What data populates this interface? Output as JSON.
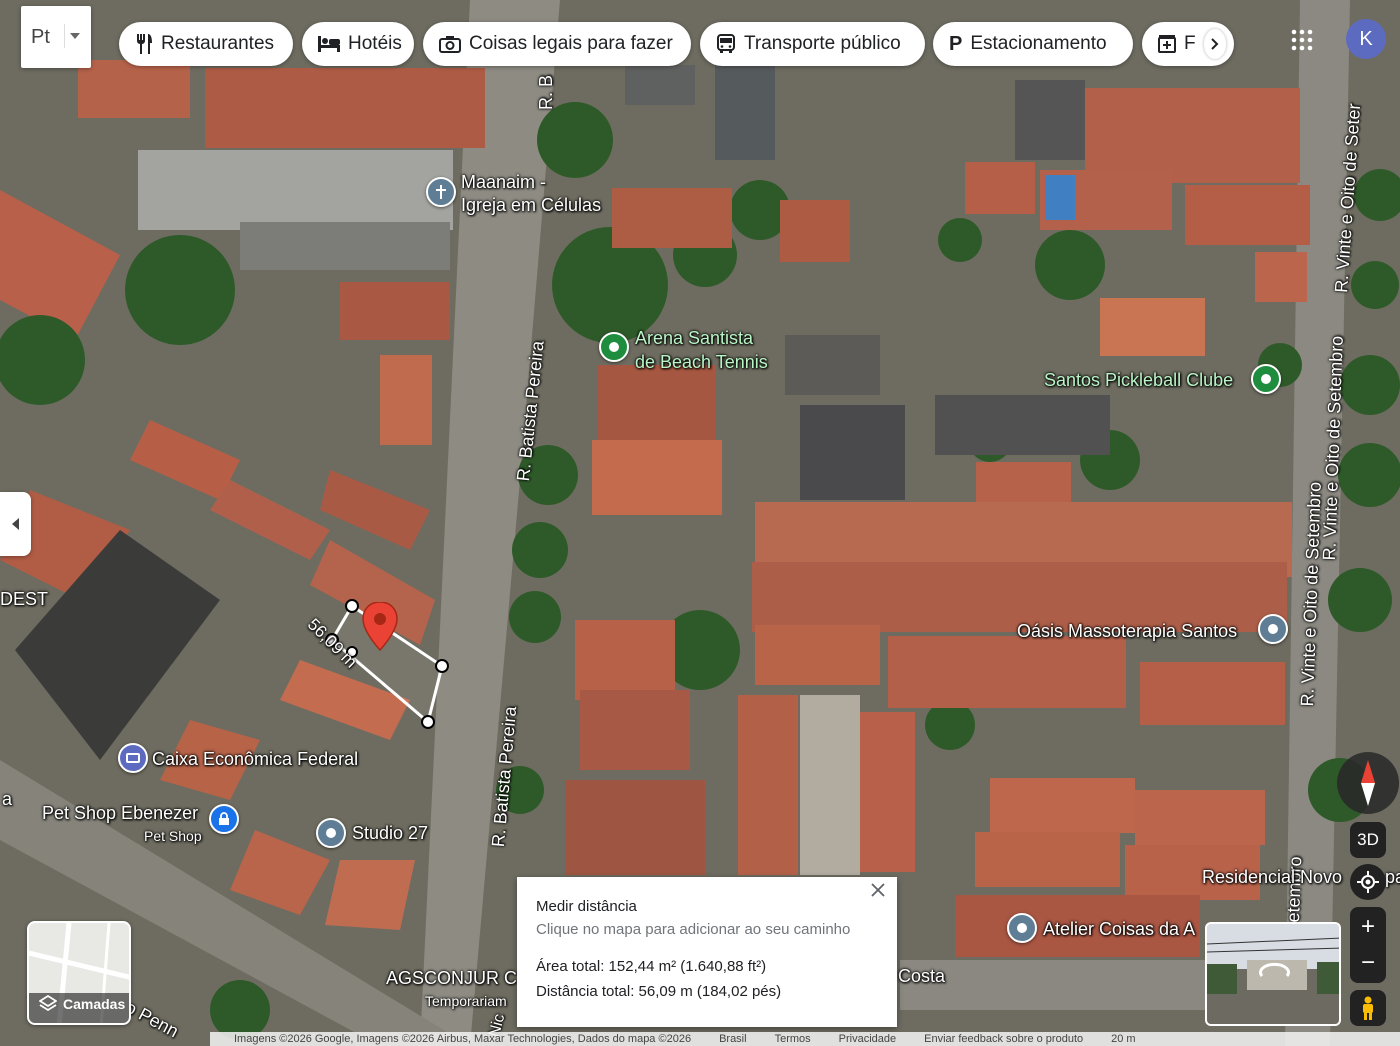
{
  "search_box": {
    "value": "Pt"
  },
  "categories": [
    {
      "label": "Restaurantes",
      "icon": "fork-knife-icon"
    },
    {
      "label": "Hotéis",
      "icon": "bed-icon"
    },
    {
      "label": "Coisas legais para fazer",
      "icon": "camera-icon"
    },
    {
      "label": "Transporte público",
      "icon": "bus-icon"
    },
    {
      "label": "Estacionamento",
      "icon": "parking-icon"
    },
    {
      "label": "F",
      "icon": "pharmacy-icon"
    }
  ],
  "account": {
    "initial": "K",
    "color": "#5c6bc0"
  },
  "streets": {
    "batista_1": "R. Batista Pereira",
    "batista_2": "R. Batista Pereira",
    "batista_top": "R. B",
    "vinte_1": "R. Vinte e Oito de Seter",
    "vinte_2": "R. Vinte e Oito de Setembro",
    "vinte_3": "R. Vinte e Oito de Setembro",
    "vinte_4": "etembro",
    "costa": "Costa",
    "dest": "DEST",
    "penn": "o Penn",
    "nic": "Nic",
    "a": "a"
  },
  "places": {
    "maanaim_1": "Maanaim -",
    "maanaim_2": "Igreja em Células",
    "arena_1": "Arena Santista",
    "arena_2": "de Beach Tennis",
    "pickleball": "Santos Pickleball Clube",
    "oasis": "Oásis Massoterapia Santos",
    "caixa": "Caixa Econômica Federal",
    "petshop": "Pet Shop Ebenezer",
    "petshop_sub": "Pet Shop",
    "studio": "Studio 27",
    "residencial": "Residencial Novo",
    "residencial_tail": "pa",
    "atelier": "Atelier Coisas da A",
    "agsconjur": "AGSCONJUR C",
    "agsconjur_sub": "Temporariam"
  },
  "measurement": {
    "segment_label": "56,09 m",
    "title": "Medir distância",
    "hint": "Clique no mapa para adicionar ao seu caminho",
    "area": "Área total: 152,44 m² (1.640,88 ft²)",
    "distance": "Distância total: 56,09 m (184,02 pés)"
  },
  "layers": {
    "label": "Camadas"
  },
  "controls": {
    "three_d": "3D",
    "zoom_in": "+",
    "zoom_out": "−"
  },
  "footer": {
    "attribution": "Imagens ©2026 Google, Imagens ©2026 Airbus, Maxar Technologies, Dados do mapa ©2026",
    "country": "Brasil",
    "terms": "Termos",
    "privacy": "Privacidade",
    "feedback": "Enviar feedback sobre o produto",
    "scale": "20 m"
  },
  "colors": {
    "roof": "#b8644a",
    "road": "#8a8a80",
    "tree": "#2f5a2a",
    "green_pin": "#1e8e3e",
    "blue_pin": "#4285f4",
    "gray_pin": "#5f7d95",
    "red_pin": "#ea4335"
  }
}
